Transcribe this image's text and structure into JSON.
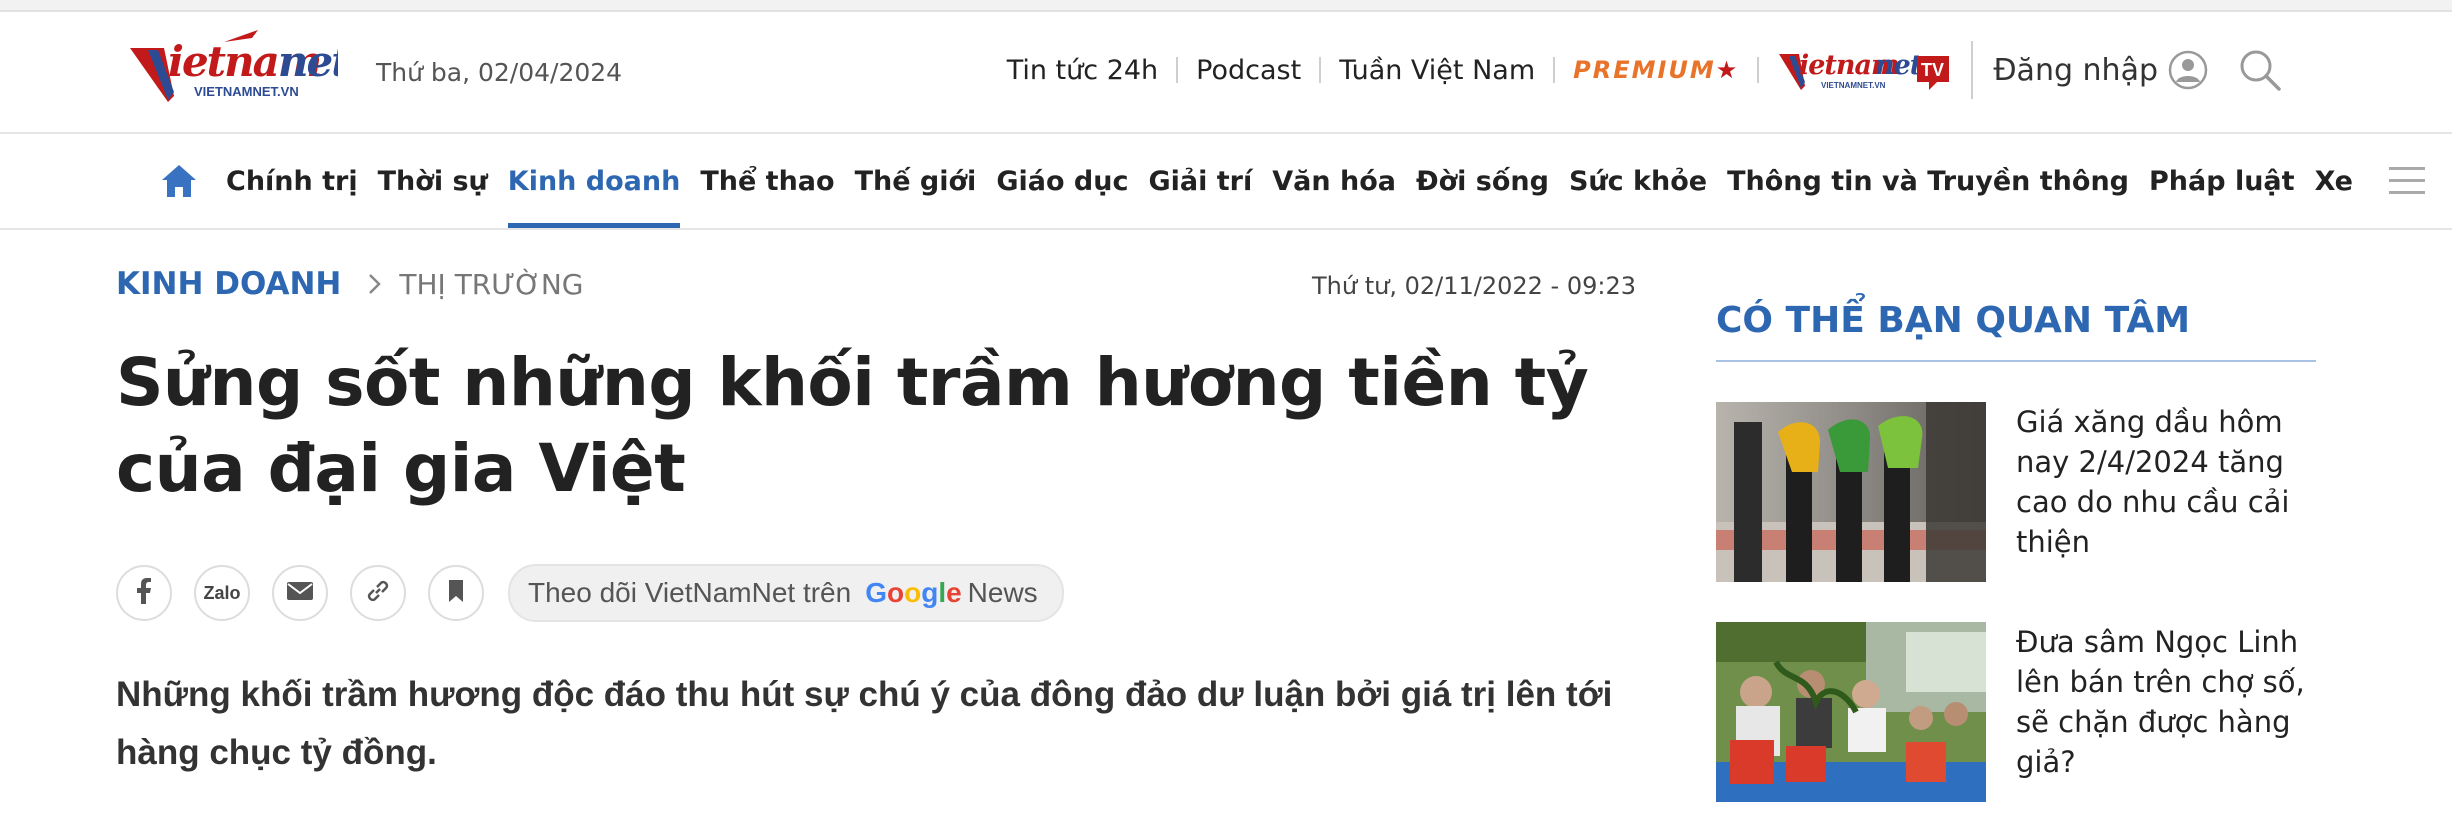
{
  "header": {
    "logo_alt": "vietnamnet",
    "logo_sub": "VIETNAMNET.VN",
    "date": "Thứ ba, 02/04/2024",
    "links": [
      "Tin tức 24h",
      "Podcast",
      "Tuần Việt Nam"
    ],
    "premium": "PREMIUM",
    "tv_logo_alt": "vietnamnet TV",
    "login_label": "Đăng nhập"
  },
  "nav": {
    "items": [
      "Chính trị",
      "Thời sự",
      "Kinh doanh",
      "Thể thao",
      "Thế giới",
      "Giáo dục",
      "Giải trí",
      "Văn hóa",
      "Đời sống",
      "Sức khỏe",
      "Thông tin và Truyền thông",
      "Pháp luật",
      "Xe"
    ],
    "active": "Kinh doanh"
  },
  "article": {
    "category": "KINH DOANH",
    "subcategory": "THỊ TRƯỜNG",
    "timestamp": "Thứ tư, 02/11/2022 - 09:23",
    "title": "Sửng sốt những khối trầm hương tiền tỷ của đại gia Việt",
    "share": {
      "facebook_icon": "facebook-icon",
      "zalo_label": "Zalo",
      "email_icon": "mail-icon",
      "link_icon": "link-icon",
      "bookmark_icon": "bookmark-icon",
      "follow_text": "Theo dõi VietNamNet trên",
      "google_logo_text": "Google",
      "news_text": "News"
    },
    "sapo": "Những khối trầm hương độc đáo thu hút sự chú ý của đông đảo dư luận bởi giá trị lên tới hàng chục tỷ đồng."
  },
  "sidebar": {
    "title": "CÓ THỂ BẠN QUAN TÂM",
    "items": [
      {
        "title": "Giá xăng dầu hôm nay 2/4/2024 tăng cao do nhu cầu cải thiện",
        "image": "fuel-pumps"
      },
      {
        "title": "Đưa sâm Ngọc Linh lên bán trên chợ số, sẽ chặn được hàng giả?",
        "image": "market-crowd"
      }
    ]
  },
  "colors": {
    "brand_blue": "#2d67b2",
    "brand_red": "#c21a1a",
    "premium_orange": "#e8742c"
  }
}
